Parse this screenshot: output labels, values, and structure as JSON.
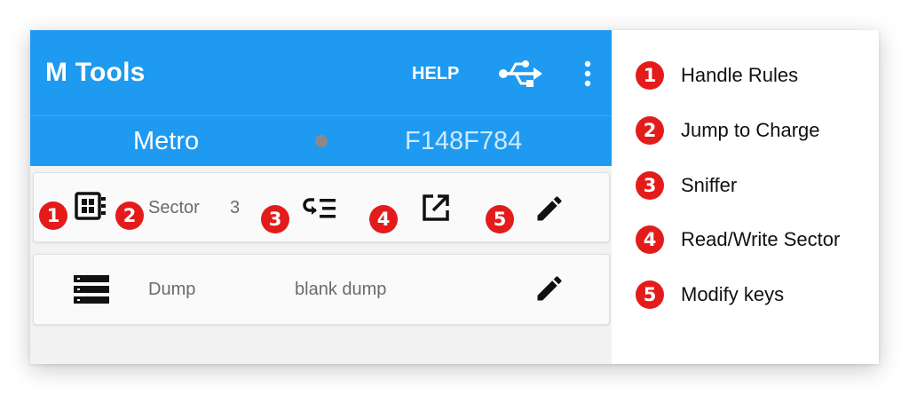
{
  "appbar": {
    "title": "M Tools",
    "help_label": "HELP",
    "usb_icon": "usb-icon",
    "more_icon": "more-vert-icon"
  },
  "card_info": {
    "name": "Metro",
    "uid": "F148F784"
  },
  "rows": [
    {
      "icon": "memory-chip-icon",
      "label": "Sector",
      "value": "3",
      "actions": [
        "jump-charge-icon",
        "open-in-new-icon",
        "edit-pencil-icon"
      ]
    },
    {
      "icon": "storage-list-icon",
      "label": "Dump",
      "value": "blank dump",
      "actions": [
        "edit-pencil-icon"
      ]
    }
  ],
  "markers": [
    "1",
    "2",
    "3",
    "4",
    "5"
  ],
  "legend": [
    {
      "num": "1",
      "text": "Handle Rules"
    },
    {
      "num": "2",
      "text": "Jump to Charge"
    },
    {
      "num": "3",
      "text": "Sniffer"
    },
    {
      "num": "4",
      "text": "Read/Write Sector"
    },
    {
      "num": "5",
      "text": "Modify keys"
    }
  ],
  "colors": {
    "appbar": "#1e9af1",
    "marker": "#e41b1b"
  }
}
